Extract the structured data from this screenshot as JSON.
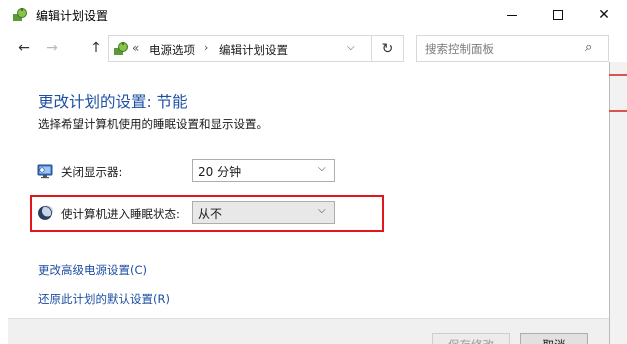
{
  "window": {
    "title": "编辑计划设置",
    "controls": {
      "minimize": "—",
      "maximize": "□",
      "close": "✕"
    }
  },
  "nav": {
    "back": "←",
    "forward": "→",
    "up": "↑",
    "overflow": "«",
    "breadcrumbs": [
      "电源选项",
      "编辑计划设置"
    ],
    "separator": "›",
    "dropdown": "⌵",
    "refresh": "↻",
    "search_placeholder": "搜索控制面板",
    "search_icon": "⌕"
  },
  "main": {
    "heading": "更改计划的设置: 节能",
    "subtext": "选择希望计算机使用的睡眠设置和显示设置。",
    "settings": [
      {
        "label": "关闭显示器:",
        "value": "20 分钟",
        "icon": "monitor-icon"
      },
      {
        "label": "使计算机进入睡眠状态:",
        "value": "从不",
        "icon": "moon-icon"
      }
    ],
    "select_arrow": "⌵",
    "links": [
      "更改高级电源设置(C)",
      "还原此计划的默认设置(R)"
    ]
  },
  "footer": {
    "save_label": "保存修改",
    "cancel_label": "取消"
  },
  "colors": {
    "link": "#1e4fa3",
    "highlight": "#e0181b"
  }
}
